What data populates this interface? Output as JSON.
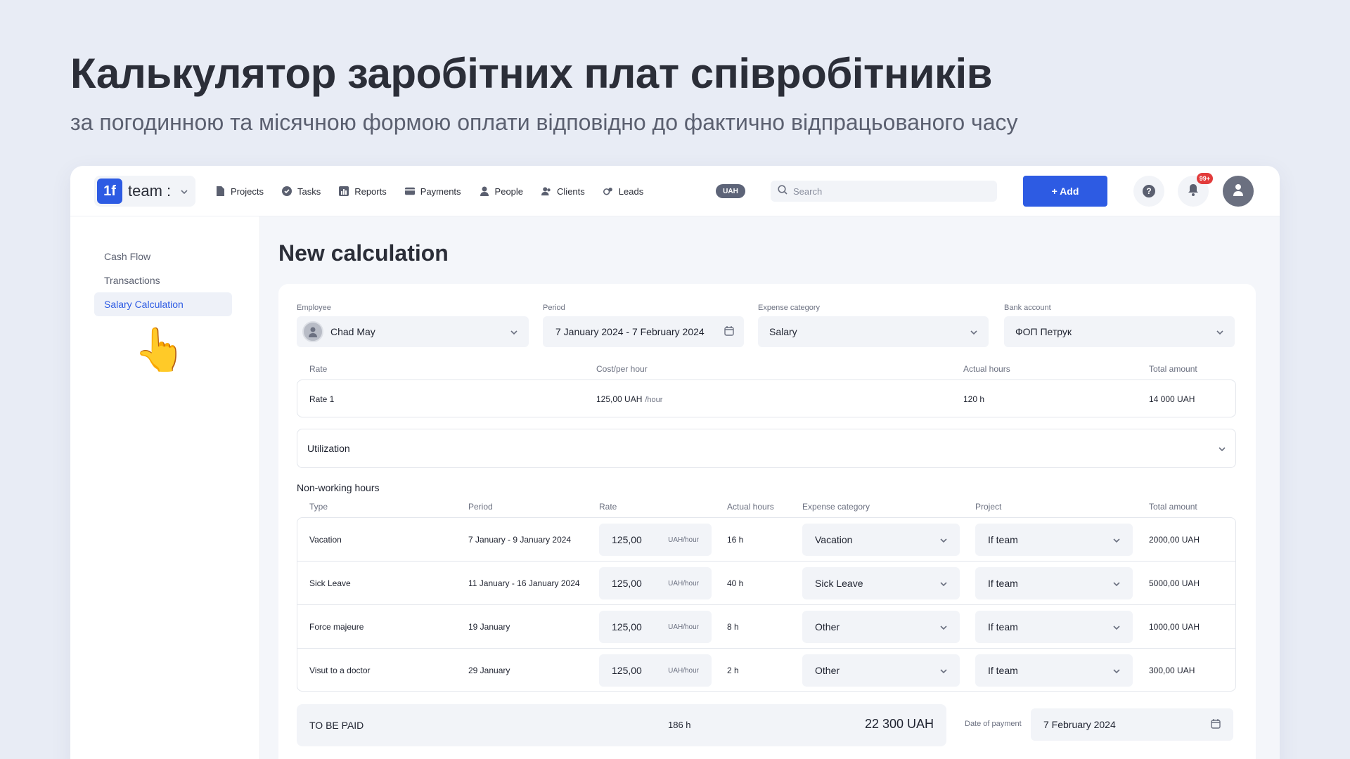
{
  "hero": {
    "title": "Калькулятор заробітних плат співробітників",
    "subtitle": "за погодинною та місячною формою оплати відповідно до фактично відпрацьованого часу"
  },
  "topbar": {
    "logo_mark": "1f",
    "logo_text": "team :",
    "nav": [
      {
        "label": "Projects",
        "icon": "document-icon"
      },
      {
        "label": "Tasks",
        "icon": "check-circle-icon"
      },
      {
        "label": "Reports",
        "icon": "bar-chart-icon"
      },
      {
        "label": "Payments",
        "icon": "card-icon"
      },
      {
        "label": "People",
        "icon": "person-icon"
      },
      {
        "label": "Clients",
        "icon": "people-icon"
      },
      {
        "label": "Leads",
        "icon": "leads-icon"
      }
    ],
    "currency": "UAH",
    "search_placeholder": "Search",
    "add_label": "+ Add",
    "help_label": "?",
    "notif_badge": "99+"
  },
  "sidebar": {
    "items": [
      "Cash Flow",
      "Transactions",
      "Salary Calculation"
    ],
    "active_index": 2,
    "pointer": "👆"
  },
  "main": {
    "title": "New calculation",
    "fields": {
      "employee_label": "Employee",
      "employee_value": "Chad May",
      "period_label": "Period",
      "period_value": "7 January 2024 - 7 February 2024",
      "expense_label": "Expense category",
      "expense_value": "Salary",
      "bank_label": "Bank account",
      "bank_value": "ФОП Петрук"
    },
    "rate_headers": [
      "Rate",
      "Cost/per hour",
      "Actual hours",
      "Total amount"
    ],
    "rate_row": {
      "rate": "Rate 1",
      "cost": "125,00 UAH",
      "unit": "/hour",
      "hours": "120 h",
      "total": "14 000 UAH"
    },
    "utilization_label": "Utilization",
    "nonworking_title": "Non-working hours",
    "nw_headers": [
      "Type",
      "Period",
      "Rate",
      "Actual hours",
      "Expense category",
      "Project",
      "Total amount"
    ],
    "nw_rows": [
      {
        "type": "Vacation",
        "period": "7 January - 9 January 2024",
        "rate": "125,00",
        "unit": "UAH/hour",
        "hours": "16 h",
        "category": "Vacation",
        "project": "If team",
        "total": "2000,00 UAH"
      },
      {
        "type": "Sick Leave",
        "period": "11 January - 16 January 2024",
        "rate": "125,00",
        "unit": "UAH/hour",
        "hours": "40 h",
        "category": "Sick Leave",
        "project": "If team",
        "total": "5000,00 UAH"
      },
      {
        "type": "Force majeure",
        "period": "19 January",
        "rate": "125,00",
        "unit": "UAH/hour",
        "hours": "8 h",
        "category": "Other",
        "project": "If team",
        "total": "1000,00 UAH"
      },
      {
        "type": "Visut to a doctor",
        "period": "29 January",
        "rate": "125,00",
        "unit": "UAH/hour",
        "hours": "2 h",
        "category": "Other",
        "project": "If team",
        "total": "300,00 UAH"
      }
    ],
    "to_be_paid_label": "TO BE PAID",
    "to_be_paid_hours": "186 h",
    "to_be_paid_total": "22 300 UAH",
    "date_of_payment_label": "Date of payment",
    "date_of_payment_value": "7 February 2024"
  },
  "colors": {
    "accent": "#2d5be3",
    "background": "#e8ecf5",
    "badge": "#e23b3b"
  }
}
